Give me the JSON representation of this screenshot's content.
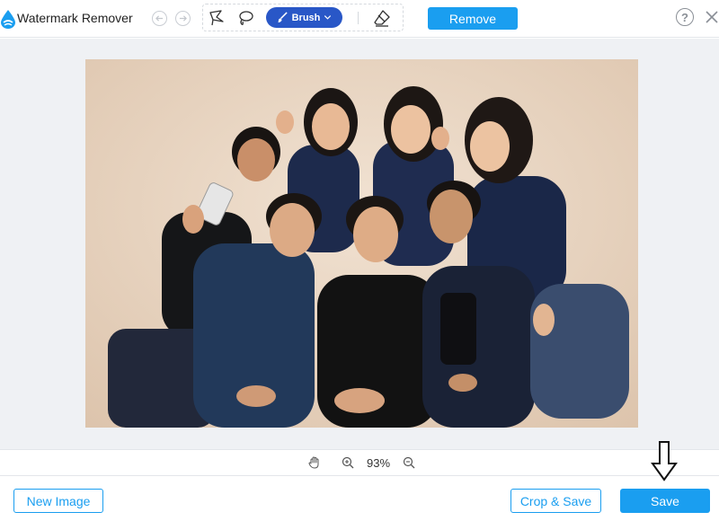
{
  "app": {
    "title": "Watermark Remover"
  },
  "toolbar": {
    "tools": [
      {
        "name": "polygonal-lasso",
        "icon": "polygon-lasso-icon"
      },
      {
        "name": "lasso",
        "icon": "lasso-icon"
      },
      {
        "name": "brush",
        "icon": "brush-icon",
        "label": "Brush",
        "active": true
      },
      {
        "name": "eraser",
        "icon": "eraser-icon"
      }
    ],
    "brush_label": "Brush",
    "remove_label": "Remove",
    "help_label": "?"
  },
  "zoom": {
    "value": "93%"
  },
  "footer": {
    "new_image_label": "New Image",
    "crop_save_label": "Crop & Save",
    "save_label": "Save"
  },
  "colors": {
    "accent": "#1a9ef0",
    "brush_active": "#2957c7",
    "canvas_bg": "#eff1f4",
    "photo_backdrop": "#e9d7c4"
  }
}
